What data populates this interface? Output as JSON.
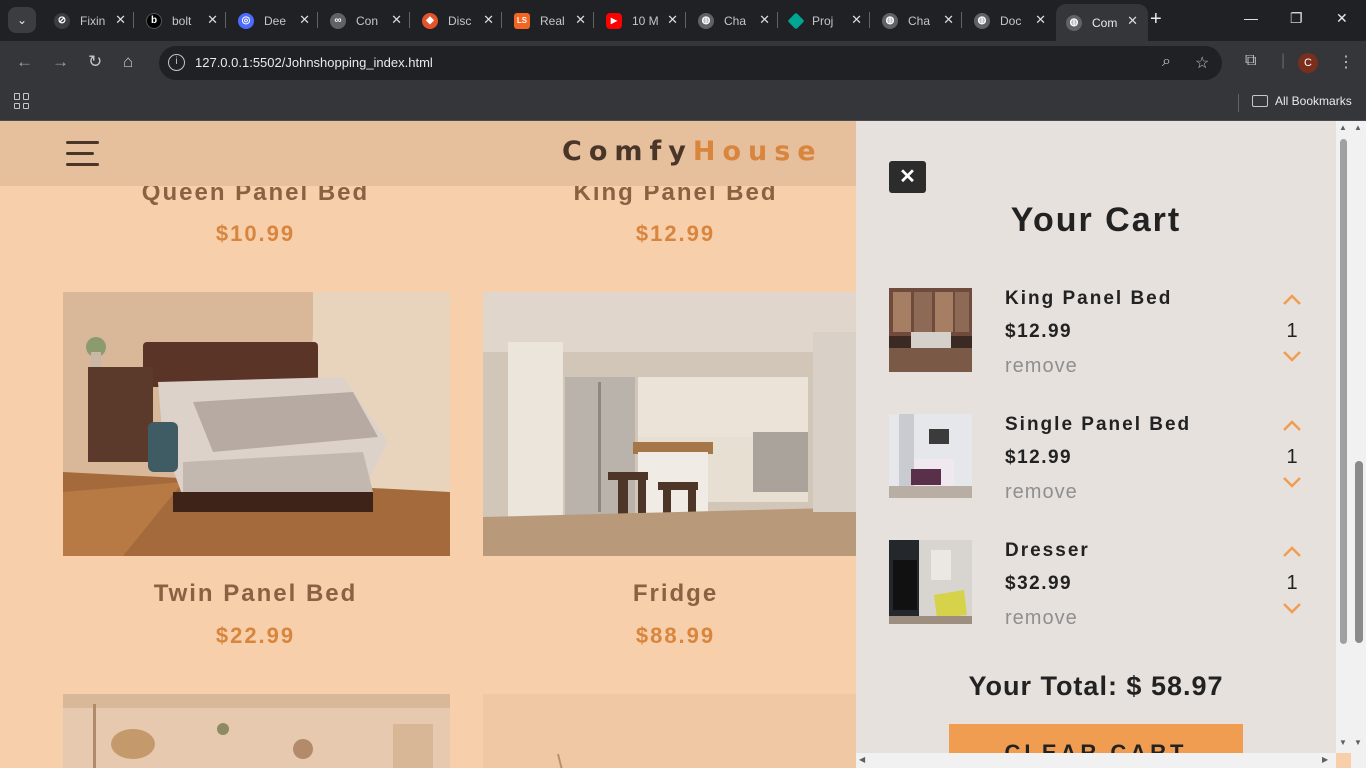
{
  "browser": {
    "tabs": [
      {
        "label": "Fixin",
        "fav_color": "#3c3d41",
        "glyph": "⊘"
      },
      {
        "label": "bolt",
        "fav_color": "#000000",
        "glyph": "b"
      },
      {
        "label": "Dee",
        "fav_color": "#4d6bfe",
        "glyph": "◎"
      },
      {
        "label": "Con",
        "fav_color": "#5f6368",
        "glyph": "∞"
      },
      {
        "label": "Disc",
        "fav_color": "#e5532d",
        "glyph": "◆"
      },
      {
        "label": "Real",
        "fav_color": "#f26522",
        "glyph": "LS"
      },
      {
        "label": "10 M",
        "fav_color": "#ff0000",
        "glyph": "▶"
      },
      {
        "label": "Cha",
        "fav_color": "#5f6368",
        "glyph": "◍"
      },
      {
        "label": "Proj",
        "fav_color": "#00a693",
        "glyph": "◆"
      },
      {
        "label": "Cha",
        "fav_color": "#5f6368",
        "glyph": "◍"
      },
      {
        "label": "Doc",
        "fav_color": "#5f6368",
        "glyph": "◍"
      },
      {
        "label": "Com",
        "fav_color": "#5f6368",
        "glyph": "◍"
      }
    ],
    "url": "127.0.0.1:5502/Johnshopping_index.html",
    "bookmarks_label": "All Bookmarks",
    "profile_initial": "C"
  },
  "site": {
    "brand_part1": "Comfy",
    "brand_part2": "House"
  },
  "products": [
    {
      "title": "Queen Panel Bed",
      "price": "$10.99"
    },
    {
      "title": "King Panel Bed",
      "price": "$12.99"
    },
    {
      "title": "Twin Panel Bed",
      "price": "$22.99"
    },
    {
      "title": "Fridge",
      "price": "$88.99"
    }
  ],
  "cart": {
    "title": "Your Cart",
    "remove_label": "remove",
    "items": [
      {
        "name": "King Panel Bed",
        "price": "$12.99",
        "qty": "1"
      },
      {
        "name": "Single Panel Bed",
        "price": "$12.99",
        "qty": "1"
      },
      {
        "name": "Dresser",
        "price": "$32.99",
        "qty": "1"
      }
    ],
    "total": "Your Total: $ 58.97",
    "clear_label": "CLEAR CART"
  }
}
